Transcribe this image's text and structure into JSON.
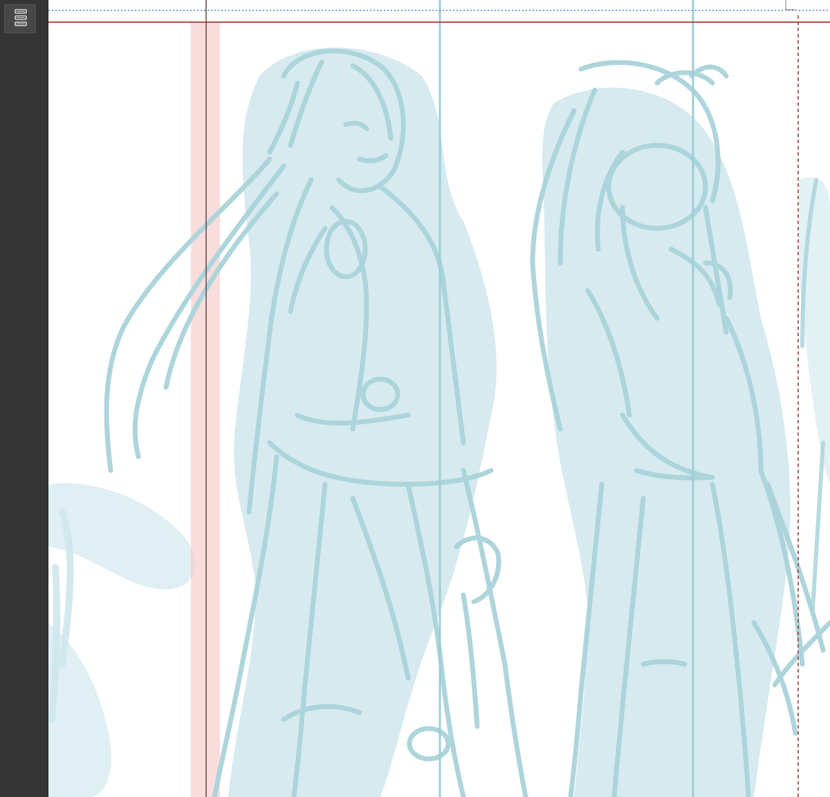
{
  "app": {
    "layers_panel_toggle": {
      "icon": "layers-panel-icon"
    }
  },
  "canvas": {
    "sketch_color": "#a9d3da",
    "wash_color": "#cfe7ec",
    "frame_line_color": "#a23a2a",
    "bleed_color": "#f3c6c4",
    "guide_blue_color": "#2a5fc9"
  }
}
